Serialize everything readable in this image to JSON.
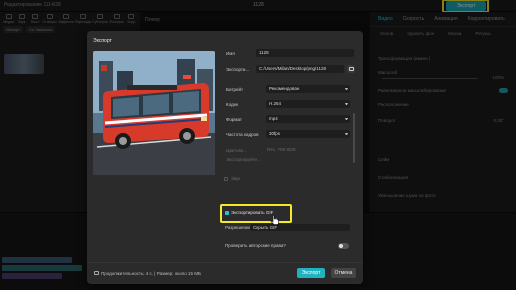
{
  "app": {
    "project_label": "Редактирование 1114/28",
    "center_title": "1128",
    "export_button": "Экспорт"
  },
  "left_panel": {
    "tabs": [
      "Медиа",
      "Звук",
      "Текст",
      "Стикеры",
      "Эффекты",
      "Переходы",
      "Субтитры",
      "Фильтры",
      "Корр"
    ],
    "subtabs": [
      "Импорт",
      "Сл Записать"
    ]
  },
  "preview_panel": {
    "title": "Плеер"
  },
  "right_panel": {
    "tabs": [
      "Видео",
      "Скорость",
      "Анимация",
      "Корректировать"
    ],
    "subtabs": [
      "Основ",
      "Удалить фон",
      "Маска",
      "Ретушь"
    ],
    "rows": [
      "Трансформация (измен.)",
      "Масштаб",
      "Равномерное масштабирование",
      "Расположение",
      "Поворот",
      "Сейм",
      "Стабилизация",
      "Уменьшение шума на фото"
    ],
    "scale_value": "100%",
    "rotation_value": "0,00°"
  },
  "dialog": {
    "title": "Экспорт",
    "fields": {
      "name_label": "Имя",
      "name_value": "1128",
      "export_to_label": "Экспорти...",
      "export_to_value": "C:/Users/Milan/Desktop/png/1128",
      "bitrate_label": "Битрейт",
      "bitrate_value": "Рекомендован",
      "codec_label": "Кодек",
      "codec_value": "H.264",
      "format_label": "Формат",
      "format_value": "mp4",
      "fps_label": "Частота кадров",
      "fps_value": "30fps",
      "color_label": "Цветово...",
      "color_value": "Rec. 709 SDR",
      "audio_codec_label": "Экспортируйте..."
    },
    "sections": {
      "audio": "Звук",
      "gif": "Экспортировать GIF",
      "resolution_label": "Разрешение",
      "resolution_value": "Скрыть GIF"
    },
    "copyright_label": "Проверить авторские права?",
    "footer": {
      "duration_text": "Продолжительность: 4 с. | Размер: около 15 МБ",
      "export_button": "Экспорт",
      "cancel_button": "Отмена"
    }
  },
  "colors": {
    "accent": "#1fb3c1",
    "highlight": "#f2ea2b",
    "dialog_bg": "#2b2b2b"
  }
}
